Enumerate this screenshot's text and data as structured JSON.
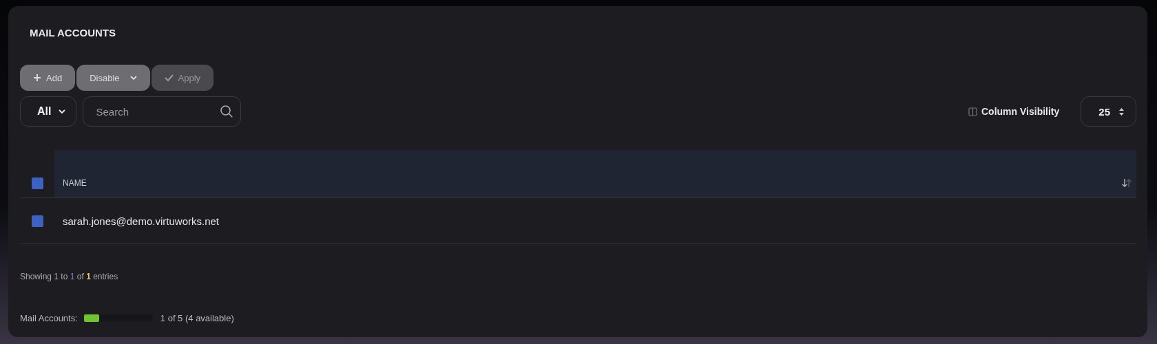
{
  "title": "MAIL ACCOUNTS",
  "actions": [
    {
      "label": "Add",
      "kind": "add",
      "disabled": false
    },
    {
      "label": "Disable",
      "kind": "menu",
      "disabled": false
    },
    {
      "label": "Apply",
      "kind": "apply",
      "disabled": true
    }
  ],
  "filter": {
    "value": "All"
  },
  "search": {
    "placeholder": "Search"
  },
  "column_visibility": {
    "label": "Column Visibility"
  },
  "page_size": {
    "value": "25"
  },
  "table": {
    "select_all": {
      "checked": true
    },
    "columns": [
      {
        "label": "NAME"
      }
    ],
    "rows": [
      {
        "checked": true,
        "name": "sarah.jones@demo.virtuworks.net"
      }
    ]
  },
  "info": [
    {
      "text": "Showing 1 to",
      "kind": "plain"
    },
    {
      "text": "1",
      "kind": "accent"
    },
    {
      "text": "of",
      "kind": "plain"
    },
    {
      "text": "1",
      "kind": "strong"
    },
    {
      "text": "entries",
      "kind": "plain"
    }
  ],
  "usage": {
    "label": "Mail Accounts:",
    "level": 0.22,
    "reading": "1 of 5 (4 available)"
  }
}
